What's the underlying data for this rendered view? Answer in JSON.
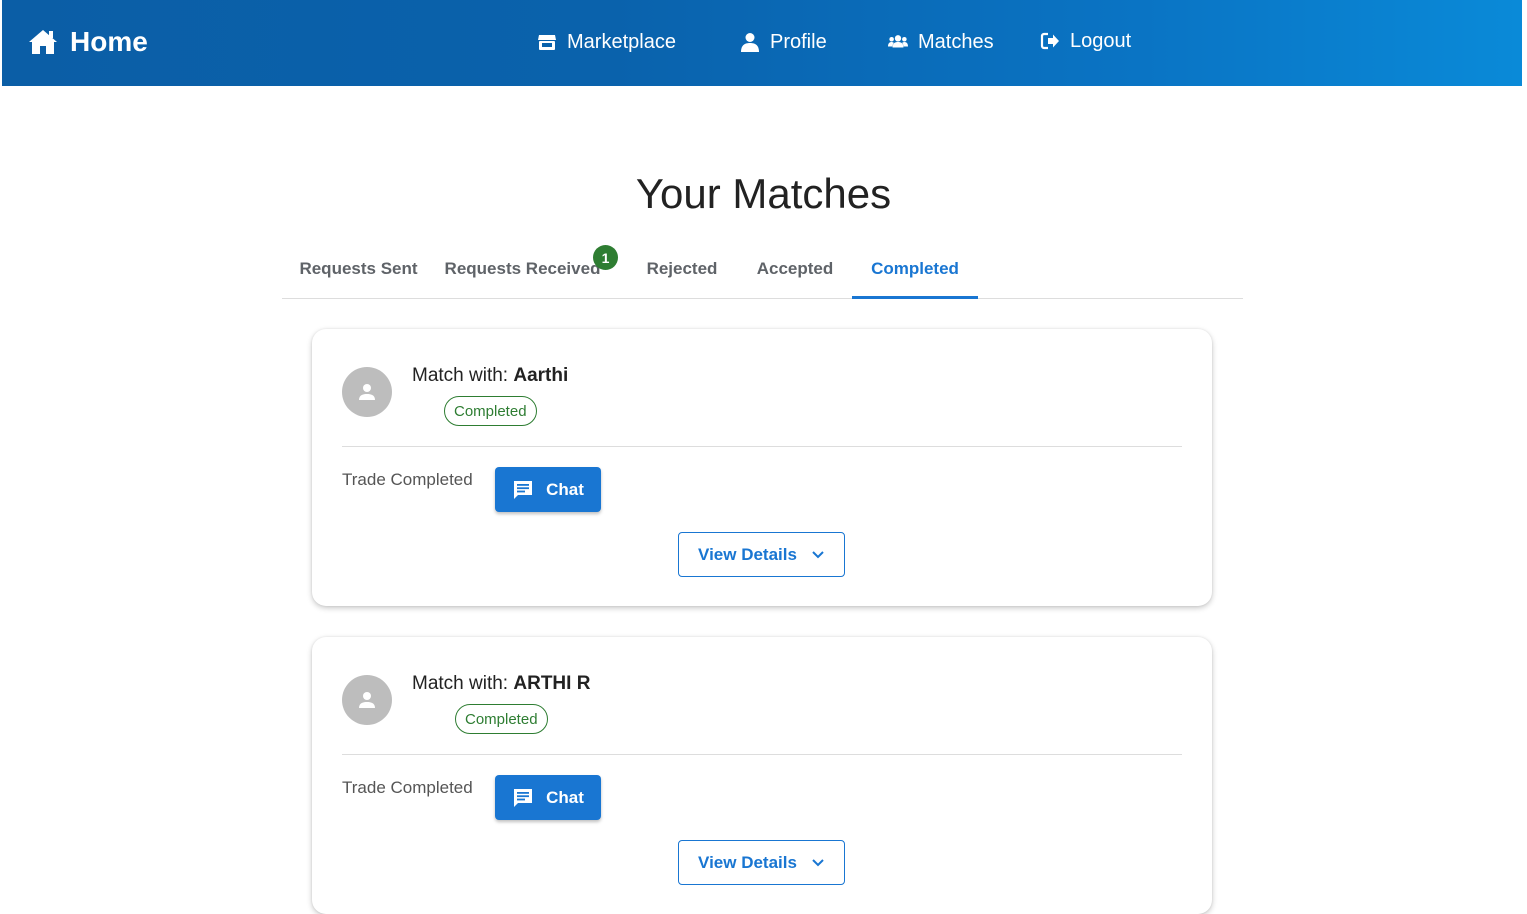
{
  "nav": {
    "home_label": "Home",
    "links": [
      {
        "label": "Marketplace",
        "icon": "store-icon"
      },
      {
        "label": "Profile",
        "icon": "user-icon"
      },
      {
        "label": "Matches",
        "icon": "users-icon"
      },
      {
        "label": "Logout",
        "icon": "logout-icon"
      }
    ],
    "bar_color_start": "#0b5ea6",
    "bar_color_end": "#0a8ad8"
  },
  "page": {
    "title": "Your Matches"
  },
  "tabs": {
    "items": [
      {
        "label": "Requests Sent"
      },
      {
        "label": "Requests Received",
        "badge": "1"
      },
      {
        "label": "Rejected"
      },
      {
        "label": "Accepted"
      },
      {
        "label": "Completed",
        "active": true
      }
    ],
    "active_color": "#1976d2"
  },
  "matches": [
    {
      "prefix": "Match with: ",
      "name": "Aarthi",
      "status": "Completed",
      "trade_label": "Trade Completed",
      "chat_label": "Chat",
      "details_label": "View Details"
    },
    {
      "prefix": "Match with: ",
      "name": "ARTHI R",
      "status": "Completed",
      "trade_label": "Trade Completed",
      "chat_label": "Chat",
      "details_label": "View Details"
    }
  ],
  "colors": {
    "primary": "#1976d2",
    "status_green": "#2e7d32",
    "avatar_gray": "#bdbdbd"
  }
}
